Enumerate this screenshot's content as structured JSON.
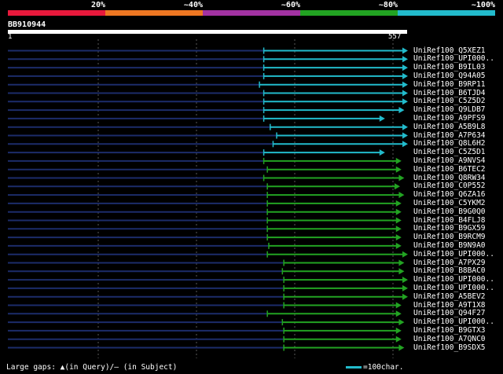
{
  "legend": {
    "labels": [
      "20%",
      "~40%",
      "~60%",
      "~80%",
      "~100%"
    ],
    "colors": [
      "#e8193c",
      "#ee7722",
      "#a232a2",
      "#22a322",
      "#22bbcc"
    ]
  },
  "query": {
    "id": "BB910944",
    "start": "1",
    "end": "557",
    "length": 557
  },
  "hits": [
    {
      "label": "UniRef100_Q5XEZ1",
      "start": 357,
      "end": 557,
      "level": 4
    },
    {
      "label": "UniRef100_UPI000..",
      "start": 357,
      "end": 557,
      "level": 4
    },
    {
      "label": "UniRef100_B9IL03",
      "start": 357,
      "end": 557,
      "level": 4
    },
    {
      "label": "UniRef100_Q94A05",
      "start": 357,
      "end": 557,
      "level": 4
    },
    {
      "label": "UniRef100_B9RP11",
      "start": 351,
      "end": 557,
      "level": 4
    },
    {
      "label": "UniRef100_B6TJD4",
      "start": 357,
      "end": 557,
      "level": 4
    },
    {
      "label": "UniRef100_C5Z5D2",
      "start": 357,
      "end": 557,
      "level": 4
    },
    {
      "label": "UniRef100_Q9LDB7",
      "start": 357,
      "end": 552,
      "level": 4
    },
    {
      "label": "UniRef100_A9PFS9",
      "start": 357,
      "end": 525,
      "level": 4
    },
    {
      "label": "UniRef100_A5B9L8",
      "start": 366,
      "end": 557,
      "level": 4
    },
    {
      "label": "UniRef100_A7P634",
      "start": 375,
      "end": 557,
      "level": 4
    },
    {
      "label": "UniRef100_Q8L6H2",
      "start": 370,
      "end": 557,
      "level": 4
    },
    {
      "label": "UniRef100_C5Z5D1",
      "start": 357,
      "end": 525,
      "level": 4
    },
    {
      "label": "UniRef100_A9NVS4",
      "start": 357,
      "end": 548,
      "level": 3
    },
    {
      "label": "UniRef100_B6TEC2",
      "start": 362,
      "end": 548,
      "level": 3
    },
    {
      "label": "UniRef100_Q8RW34",
      "start": 357,
      "end": 552,
      "level": 3
    },
    {
      "label": "UniRef100_C0P552",
      "start": 362,
      "end": 546,
      "level": 3
    },
    {
      "label": "UniRef100_Q6ZA16",
      "start": 362,
      "end": 552,
      "level": 3
    },
    {
      "label": "UniRef100_C5YKM2",
      "start": 362,
      "end": 548,
      "level": 3
    },
    {
      "label": "UniRef100_B9G0Q0",
      "start": 362,
      "end": 548,
      "level": 3
    },
    {
      "label": "UniRef100_B4FLJ8",
      "start": 362,
      "end": 548,
      "level": 3
    },
    {
      "label": "UniRef100_B9GX59",
      "start": 362,
      "end": 548,
      "level": 3
    },
    {
      "label": "UniRef100_B9RCM9",
      "start": 362,
      "end": 548,
      "level": 3
    },
    {
      "label": "UniRef100_B9N9A0",
      "start": 364,
      "end": 548,
      "level": 3
    },
    {
      "label": "UniRef100_UPI000..",
      "start": 362,
      "end": 557,
      "level": 3
    },
    {
      "label": "UniRef100_A7PX29",
      "start": 385,
      "end": 552,
      "level": 3
    },
    {
      "label": "UniRef100_B8BAC0",
      "start": 383,
      "end": 552,
      "level": 3
    },
    {
      "label": "UniRef100_UPI000..",
      "start": 385,
      "end": 557,
      "level": 3
    },
    {
      "label": "UniRef100_UPI000..",
      "start": 385,
      "end": 557,
      "level": 3
    },
    {
      "label": "UniRef100_A5BEV2",
      "start": 385,
      "end": 557,
      "level": 3
    },
    {
      "label": "UniRef100_A9T1X8",
      "start": 385,
      "end": 548,
      "level": 3
    },
    {
      "label": "UniRef100_Q94F27",
      "start": 362,
      "end": 548,
      "level": 3
    },
    {
      "label": "UniRef100_UPI000..",
      "start": 383,
      "end": 552,
      "level": 3
    },
    {
      "label": "UniRef100_B9GTX3",
      "start": 385,
      "end": 548,
      "level": 3
    },
    {
      "label": "UniRef100_A7QNC0",
      "start": 385,
      "end": 548,
      "level": 3
    },
    {
      "label": "UniRef100_B9SDX5",
      "start": 385,
      "end": 552,
      "level": 3
    }
  ],
  "footer": {
    "gaps_label": "Large gaps: ▲(in Query)/– (in Subject)",
    "scale_label": "=100char.",
    "scale_color": "#22bbcc"
  }
}
